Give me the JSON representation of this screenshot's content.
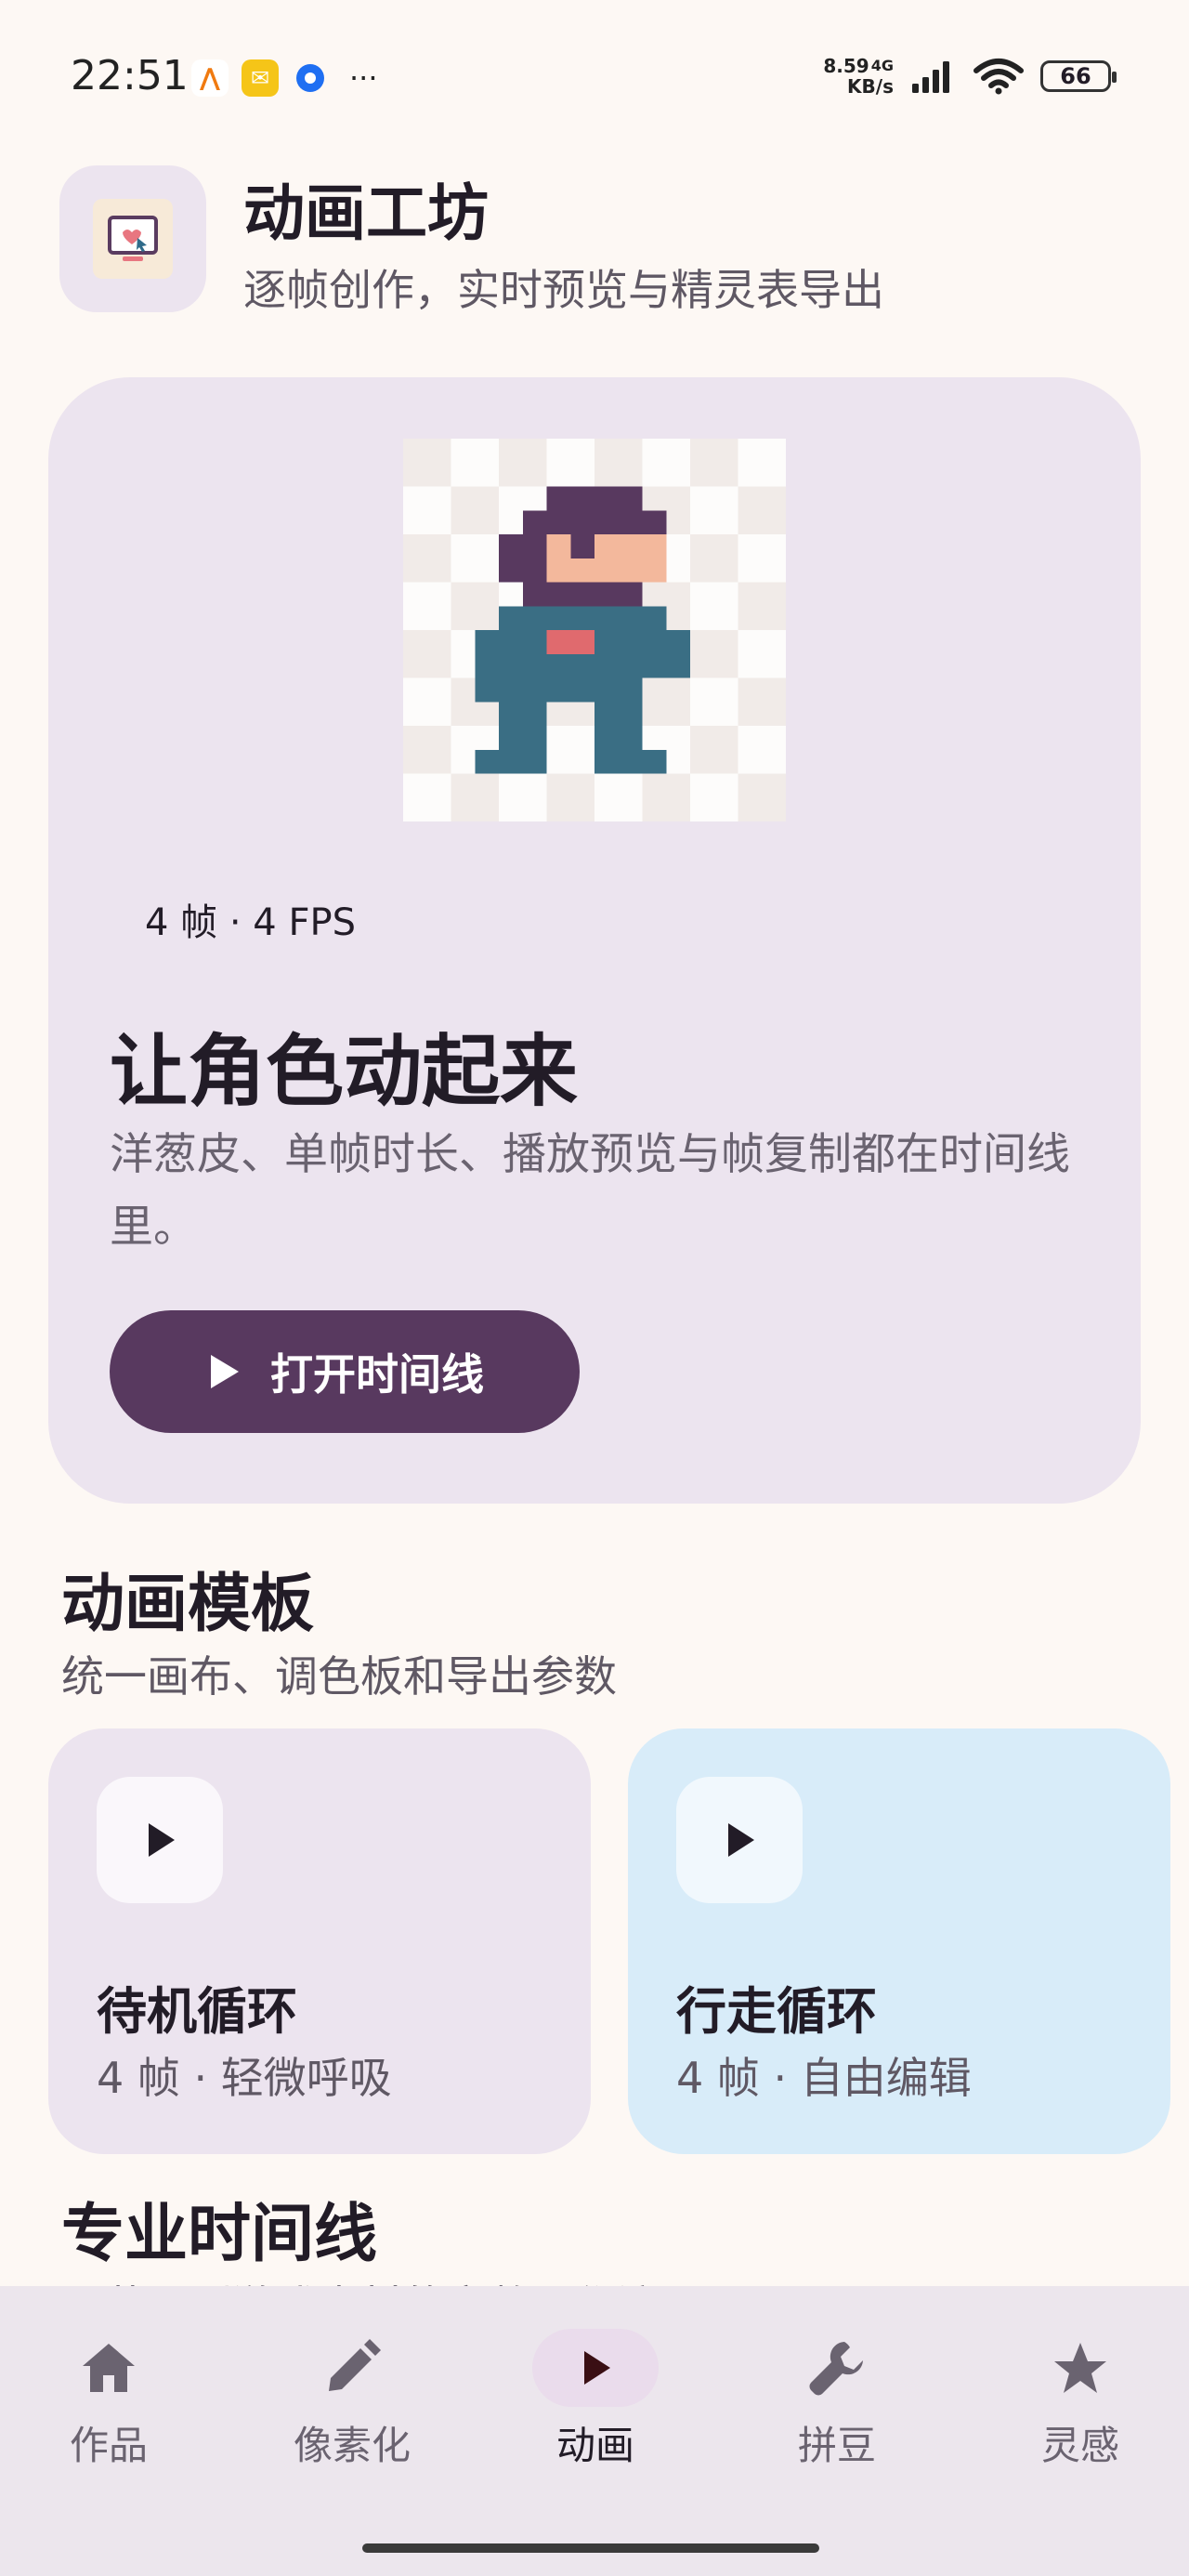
{
  "status_bar": {
    "time": "22:51",
    "app_icons": [
      "aliyun-icon",
      "mail-icon",
      "browser-icon"
    ],
    "more": "···",
    "net_speed_value": "8.59",
    "net_speed_unit": "KB/s",
    "network_type": "4G",
    "battery": "66"
  },
  "header": {
    "title": "动画工坊",
    "subtitle": "逐帧创作，实时预览与精灵表导出"
  },
  "hero": {
    "frames_fps": "4 帧 · 4 FPS",
    "title": "让角色动起来",
    "description": "洋葱皮、单帧时长、播放预览与帧复制都在时间线里。",
    "button_label": "打开时间线"
  },
  "templates": {
    "title": "动画模板",
    "subtitle": "统一画布、调色板和导出参数",
    "items": [
      {
        "name": "待机循环",
        "info": "4 帧 · 轻微呼吸",
        "bg": "#ece4ef"
      },
      {
        "name": "行走循环",
        "info": "4 帧 · 自由编辑",
        "bg": "#d8ecf9"
      }
    ]
  },
  "pro_timeline": {
    "title": "专业时间线",
    "subtitle": "从草图到游戏素材的完整工作流"
  },
  "bottom_nav": {
    "items": [
      {
        "label": "作品",
        "icon": "home-icon"
      },
      {
        "label": "像素化",
        "icon": "pencil-icon"
      },
      {
        "label": "动画",
        "icon": "play-icon",
        "active": true
      },
      {
        "label": "拼豆",
        "icon": "wrench-icon"
      },
      {
        "label": "灵感",
        "icon": "star-icon"
      }
    ]
  },
  "colors": {
    "accent": "#58395f",
    "hero_bg": "#ece4ef",
    "walk_card_bg": "#d8ecf9",
    "page_bg": "#fdf8f4"
  }
}
